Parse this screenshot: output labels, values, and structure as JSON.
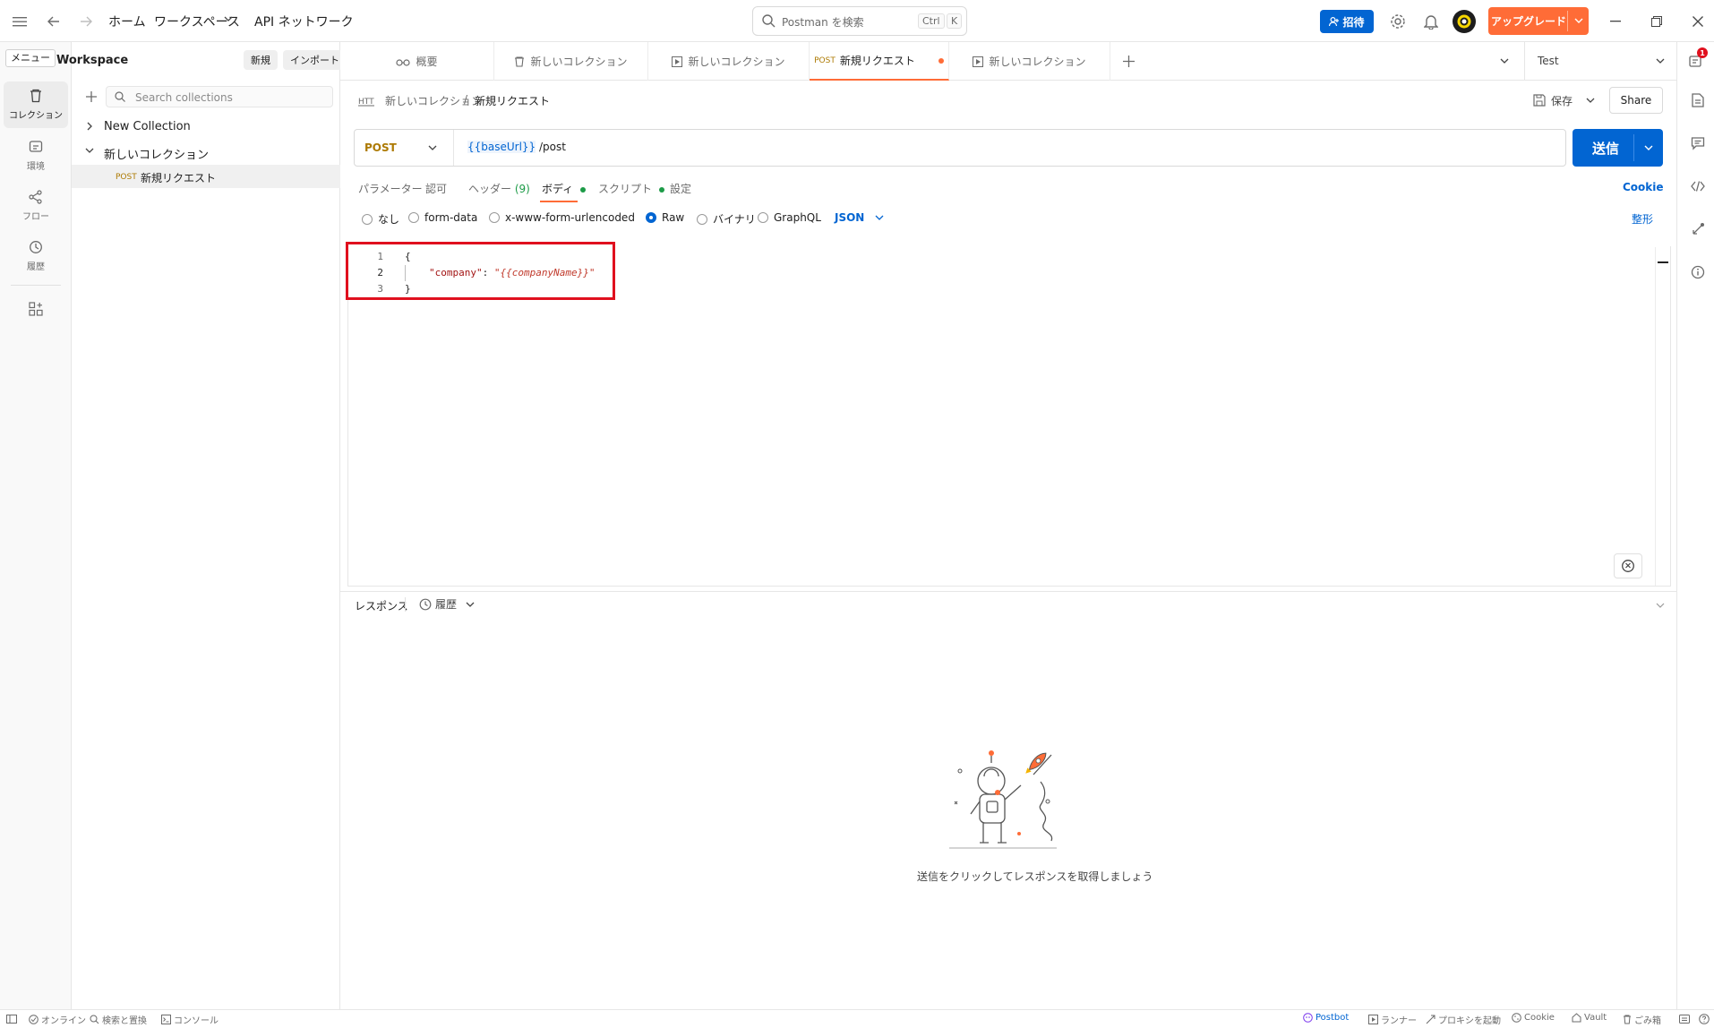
{
  "titlebar": {
    "nav_home": "ホーム",
    "nav_workspaces": "ワークスペース",
    "nav_api_network": "API ネットワーク",
    "search_placeholder": "Postman を検索",
    "search_kbd_ctrl": "Ctrl",
    "search_kbd_k": "K",
    "invite_label": "招待",
    "upgrade_label": "アップグレード"
  },
  "tooltip": {
    "menu": "メニュー"
  },
  "workspace": {
    "name": "y Workspace",
    "new_label": "新規",
    "import_label": "インポート"
  },
  "rail": [
    {
      "label": "コレクション",
      "icon": "trash-icon"
    },
    {
      "label": "環境",
      "icon": "environment-icon"
    },
    {
      "label": "フロー",
      "icon": "flows-icon"
    },
    {
      "label": "履歴",
      "icon": "history-icon"
    },
    {
      "label": "",
      "icon": "apps-icon"
    }
  ],
  "sidebar": {
    "search_placeholder": "Search collections",
    "tree": [
      {
        "label": "New Collection"
      },
      {
        "label": "新しいコレクション"
      },
      {
        "method": "POST",
        "label": "新規リクエスト"
      }
    ]
  },
  "tabs": [
    {
      "label": "概要"
    },
    {
      "label": "新しいコレクション"
    },
    {
      "label": "新しいコレクション"
    },
    {
      "method": "POST",
      "label": "新規リクエスト"
    },
    {
      "label": "新しいコレクション"
    }
  ],
  "environment": {
    "selected": "Test"
  },
  "request": {
    "breadcrumb_parent": "新しいコレクション",
    "breadcrumb_sep": "/",
    "breadcrumb_current": "新規リクエスト",
    "save_label": "保存",
    "share_label": "Share",
    "method": "POST",
    "url_var": "{{baseUrl}}",
    "url_path": " /post",
    "send_label": "送信",
    "tabs": {
      "params": "パラメーター",
      "auth": "認可",
      "headers": "ヘッダー",
      "headers_count": "(9)",
      "body": "ボディ",
      "scripts": "スクリプト",
      "settings": "設定"
    },
    "cookie_label": "Cookie",
    "body_options": {
      "none": "なし",
      "form_data": "form-data",
      "urlencoded": "x-www-form-urlencoded",
      "raw": "Raw",
      "binary": "バイナリ",
      "graphql": "GraphQL",
      "format": "JSON",
      "beautify": "整形"
    },
    "code_lines": [
      {
        "num": "1",
        "text": "{"
      },
      {
        "num": "2",
        "key": "\"company\"",
        "colon": ": ",
        "value": "\"{{companyName}}\""
      },
      {
        "num": "3",
        "text": "}"
      }
    ]
  },
  "response": {
    "title": "レスポンス",
    "history_label": "履歴",
    "empty_hint": "送信をクリックしてレスポンスを取得しましょう"
  },
  "statusbar": {
    "online": "オンライン",
    "find_replace": "検索と置換",
    "console": "コンソール",
    "postbot": "Postbot",
    "runner": "ランナー",
    "proxy": "プロキシを起動",
    "cookie": "Cookie",
    "vault": "Vault",
    "trash": "ごみ箱"
  },
  "colors": {
    "accent_blue": "#0265d2",
    "brand_orange": "#ff6c37",
    "highlight_red": "#e0101e",
    "method_post": "#ad7a03"
  },
  "notification_badge": "1"
}
